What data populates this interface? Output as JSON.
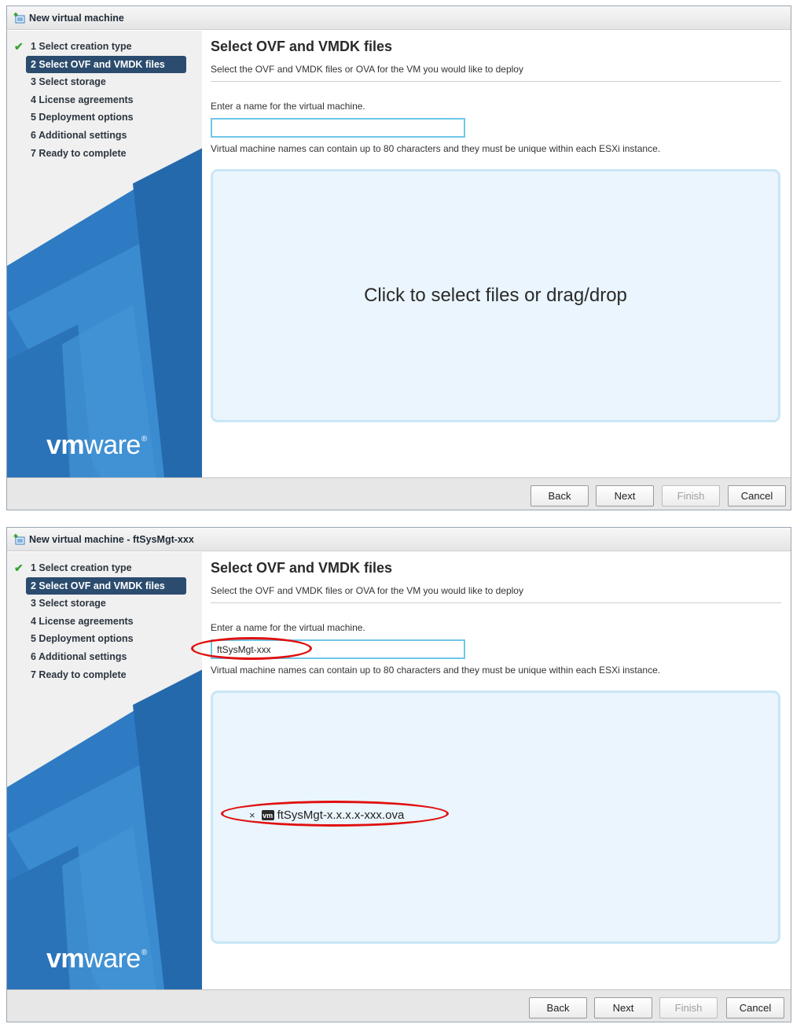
{
  "colors": {
    "active_step_bg": "#2b4c6e",
    "dropzone_bg": "#eaf5fd",
    "dropzone_border": "#c9e6f6",
    "input_border": "#6ec7ea",
    "annotation": "#e01010",
    "check": "#3aa335"
  },
  "steps": [
    {
      "label": "1 Select creation type",
      "completed": true
    },
    {
      "label": "2 Select OVF and VMDK files",
      "active": true
    },
    {
      "label": "3 Select storage"
    },
    {
      "label": "4 License agreements"
    },
    {
      "label": "5 Deployment options"
    },
    {
      "label": "6 Additional settings"
    },
    {
      "label": "7 Ready to complete"
    }
  ],
  "logo": {
    "vm": "vm",
    "ware": "ware",
    "mark": "®"
  },
  "page": {
    "heading": "Select OVF and VMDK files",
    "subtitle": "Select the OVF and VMDK files or OVA for the VM you would like to deploy",
    "name_label": "Enter a name for the virtual machine.",
    "name_hint": "Virtual machine names can contain up to 80 characters and they must be unique within each ESXi instance."
  },
  "buttons": {
    "back": "Back",
    "next": "Next",
    "finish": "Finish",
    "cancel": "Cancel"
  },
  "dialog1": {
    "title": "New virtual machine",
    "name_value": "",
    "dropzone_text": "Click to select files or drag/drop"
  },
  "dialog2": {
    "title": "New virtual machine - ftSysMgt-xxx",
    "name_value": "ftSysMgt-xxx",
    "file": {
      "remove": "×",
      "badge": "vm",
      "name": "ftSysMgt-x.x.x.x-xxx.ova"
    }
  }
}
